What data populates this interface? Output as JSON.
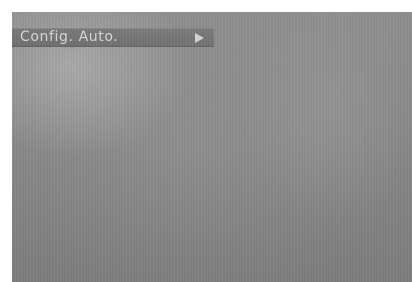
{
  "menu": {
    "label": "Config. Auto.",
    "arrow_icon": "play-right-icon"
  }
}
